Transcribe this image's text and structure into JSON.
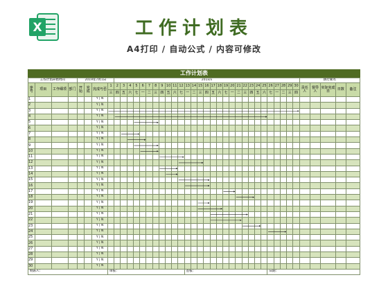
{
  "header": {
    "title": "工作计划表",
    "subtitle": "A4打印 / 自动公式 / 内容可修改",
    "logo_letter": "X",
    "logo_color": "#21a366"
  },
  "sheet": {
    "title": "工作计划表",
    "info": {
      "label1": "工作计划开始时间",
      "date": "2019年7月1日",
      "month": "201x/x",
      "label2": "执行要点"
    },
    "columns": {
      "seq": "序号",
      "item": "项目",
      "detail": "工作细项",
      "dept": "部门",
      "start": "开始",
      "done": "完成",
      "status": "完成与否",
      "owner": "责任人",
      "reviewer": "督导人",
      "actual": "实际完成日",
      "days": "日数",
      "note": "备注"
    },
    "days": [
      "1",
      "2",
      "3",
      "4",
      "5",
      "6",
      "7",
      "8",
      "9",
      "10",
      "11",
      "12",
      "13",
      "14",
      "15",
      "16",
      "17",
      "18",
      "19",
      "20",
      "21",
      "22",
      "23",
      "24",
      "25",
      "26",
      "27",
      "28",
      "29",
      "30"
    ],
    "weekdays": [
      "三",
      "四",
      "五",
      "六",
      "七",
      "一",
      "二",
      "三",
      "四",
      "五",
      "六",
      "七",
      "一",
      "二",
      "三",
      "四",
      "五",
      "六",
      "七",
      "一",
      "二",
      "三",
      "四",
      "五",
      "六",
      "七",
      "一",
      "二",
      "三",
      "四"
    ],
    "row_numbers": [
      "1",
      "2",
      "3",
      "4",
      "5",
      "6",
      "7",
      "8",
      "9",
      "10",
      "11",
      "12",
      "13",
      "14",
      "15",
      "16",
      "17",
      "18",
      "19",
      "20",
      "21",
      "22",
      "23",
      "24",
      "25",
      "26",
      "27",
      "28",
      "29",
      "30"
    ],
    "yn": {
      "y": "Y",
      "n": "N"
    },
    "footer": {
      "recorder": "制表人：",
      "reviewer": "审核：",
      "approver": "签核：",
      "date": "日期："
    },
    "gantt": [
      {
        "row": 3,
        "start": 1,
        "end": 30
      },
      {
        "row": 4,
        "start": 2,
        "end": 25
      },
      {
        "row": 5,
        "start": 5,
        "end": 8
      },
      {
        "row": 7,
        "start": 3,
        "end": 5
      },
      {
        "row": 8,
        "start": 4,
        "end": 6
      },
      {
        "row": 9,
        "start": 5,
        "end": 8
      },
      {
        "row": 10,
        "start": 6,
        "end": 8
      },
      {
        "row": 11,
        "start": 9,
        "end": 12
      },
      {
        "row": 12,
        "start": 12,
        "end": 15
      },
      {
        "row": 13,
        "start": 9,
        "end": 11
      },
      {
        "row": 14,
        "start": 10,
        "end": 11
      },
      {
        "row": 15,
        "start": 12,
        "end": 16
      },
      {
        "row": 16,
        "start": 13,
        "end": 16
      },
      {
        "row": 17,
        "start": 19,
        "end": 20
      },
      {
        "row": 18,
        "start": 21,
        "end": 23
      },
      {
        "row": 19,
        "start": 15,
        "end": 16
      },
      {
        "row": 20,
        "start": 15,
        "end": 18
      },
      {
        "row": 21,
        "start": 17,
        "end": 22
      },
      {
        "row": 22,
        "start": 17,
        "end": 21
      },
      {
        "row": 23,
        "start": 22,
        "end": 24
      },
      {
        "row": 24,
        "start": 26,
        "end": 28
      }
    ]
  }
}
